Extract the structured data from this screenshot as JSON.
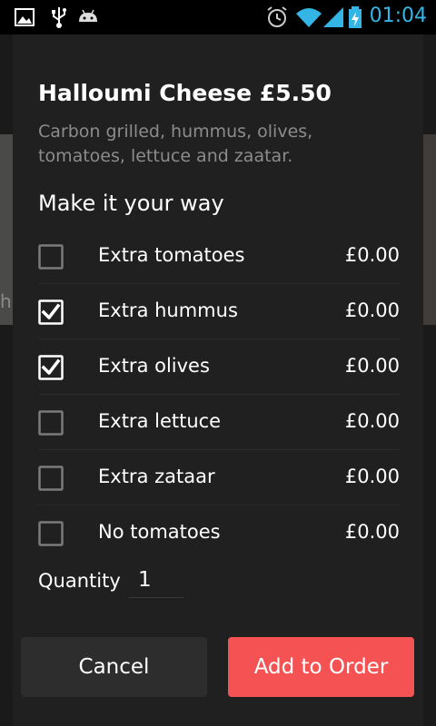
{
  "status_bar": {
    "time": "01:04",
    "icons": [
      "picture-icon",
      "usb-icon",
      "android-icon",
      "alarm-icon",
      "wifi-icon",
      "signal-icon",
      "battery-charging-icon"
    ],
    "time_color": "#33b5e5"
  },
  "background": {
    "partial_letter": "h"
  },
  "dialog": {
    "title": "Halloumi Cheese £5.50",
    "description": "Carbon grilled, hummus, olives, tomatoes, lettuce and zaatar.",
    "section_title": "Make it your way",
    "options": [
      {
        "label": "Extra tomatoes",
        "price": "£0.00",
        "checked": false
      },
      {
        "label": "Extra hummus",
        "price": "£0.00",
        "checked": true
      },
      {
        "label": "Extra olives",
        "price": "£0.00",
        "checked": true
      },
      {
        "label": "Extra lettuce",
        "price": "£0.00",
        "checked": false
      },
      {
        "label": "Extra zataar",
        "price": "£0.00",
        "checked": false
      },
      {
        "label": "No tomatoes",
        "price": "£0.00",
        "checked": false
      }
    ],
    "quantity_label": "Quantity",
    "quantity_value": "1",
    "cancel_label": "Cancel",
    "add_label": "Add to Order"
  },
  "colors": {
    "accent": "#f55353",
    "description": "#8c8c8c",
    "dialog_bg": "#202020"
  }
}
